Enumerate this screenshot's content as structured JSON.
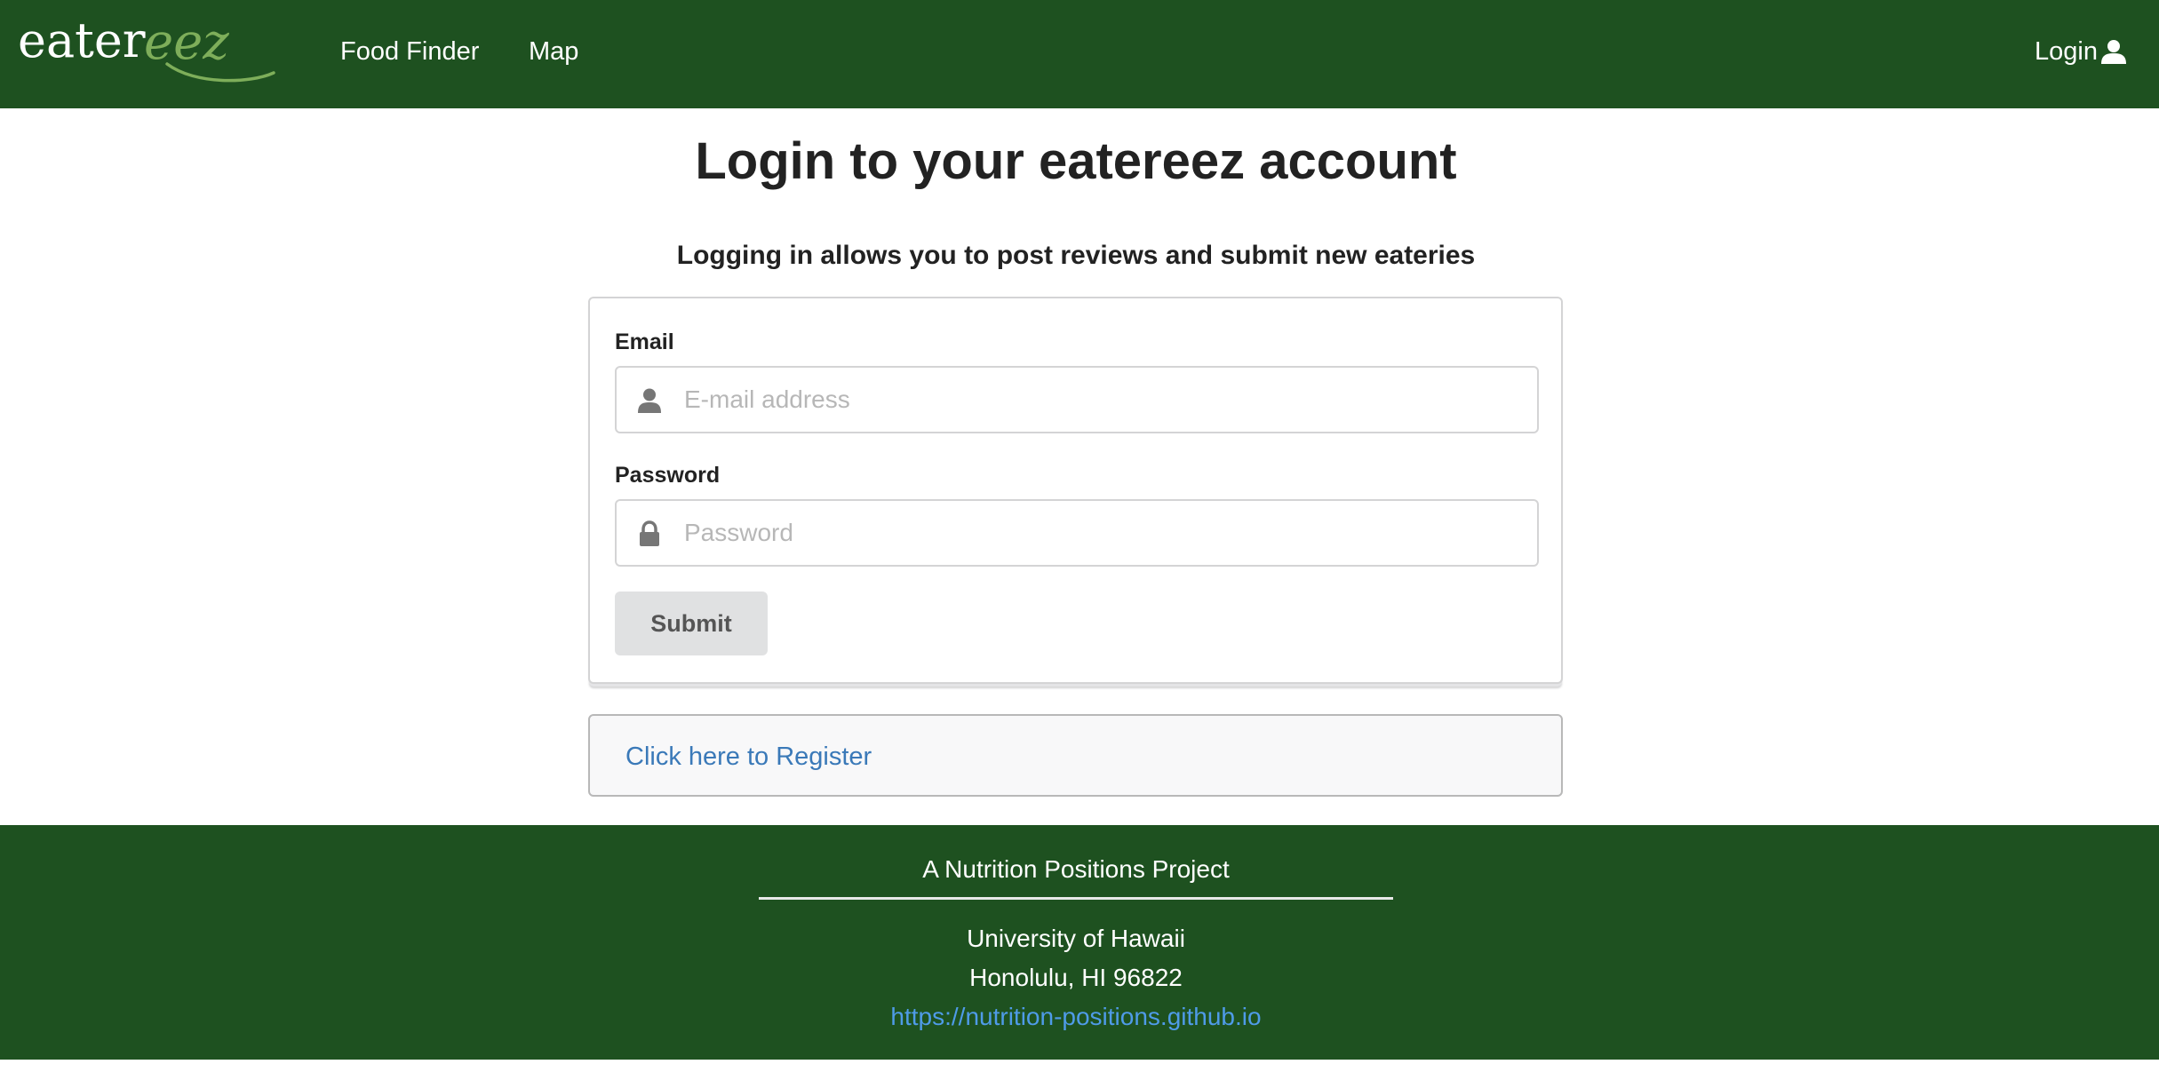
{
  "navbar": {
    "logo": {
      "primary": "eater",
      "accent": "eez"
    },
    "links": [
      {
        "label": "Food Finder"
      },
      {
        "label": "Map"
      }
    ],
    "login_label": "Login"
  },
  "main": {
    "title": "Login to your eatereez account",
    "subtitle": "Logging in allows you to post reviews and submit new eateries",
    "form": {
      "email_label": "Email",
      "email_placeholder": "E-mail address",
      "email_value": "",
      "password_label": "Password",
      "password_placeholder": "Password",
      "password_value": "",
      "submit_label": "Submit"
    },
    "register_link": "Click here to Register"
  },
  "footer": {
    "title": "A Nutrition Positions Project",
    "university": "University of Hawaii",
    "city": "Honolulu, HI 96822",
    "url": "https://nutrition-positions.github.io"
  },
  "colors": {
    "brand_green": "#1e5120",
    "logo_accent": "#7eae5a",
    "link_blue": "#3a79b8",
    "footer_link": "#4f9be8"
  },
  "icons": {
    "nav_login": "user-icon",
    "email_field": "user-icon",
    "password_field": "lock-icon"
  }
}
